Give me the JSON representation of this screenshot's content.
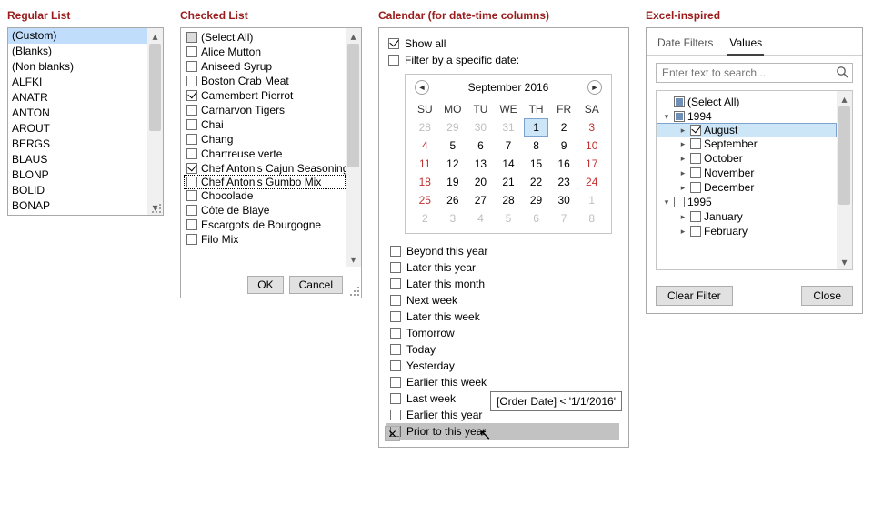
{
  "titles": {
    "regular": "Regular List",
    "checked": "Checked List",
    "calendar": "Calendar (for date-time columns)",
    "excel": "Excel-inspired"
  },
  "regular": {
    "items": [
      "(Custom)",
      "(Blanks)",
      "(Non blanks)",
      "ALFKI",
      "ANATR",
      "ANTON",
      "AROUT",
      "BERGS",
      "BLAUS",
      "BLONP",
      "BOLID",
      "BONAP"
    ],
    "selected_index": 0
  },
  "checked": {
    "items": [
      {
        "label": "(Select All)",
        "state": "ind"
      },
      {
        "label": "Alice Mutton",
        "state": "off"
      },
      {
        "label": "Aniseed Syrup",
        "state": "off"
      },
      {
        "label": "Boston Crab Meat",
        "state": "off"
      },
      {
        "label": "Camembert Pierrot",
        "state": "on"
      },
      {
        "label": "Carnarvon Tigers",
        "state": "off"
      },
      {
        "label": "Chai",
        "state": "off"
      },
      {
        "label": "Chang",
        "state": "off"
      },
      {
        "label": "Chartreuse verte",
        "state": "off"
      },
      {
        "label": "Chef Anton's Cajun Seasoning",
        "state": "on"
      },
      {
        "label": "Chef Anton's Gumbo Mix",
        "state": "off",
        "hover": true
      },
      {
        "label": "Chocolade",
        "state": "off"
      },
      {
        "label": "Côte de Blaye",
        "state": "off"
      },
      {
        "label": "Escargots de Bourgogne",
        "state": "off"
      },
      {
        "label": "Filo Mix",
        "state": "off"
      }
    ],
    "ok": "OK",
    "cancel": "Cancel"
  },
  "calendar": {
    "show_all": "Show all",
    "filter_date": "Filter by a specific date:",
    "month": "September 2016",
    "dow": [
      "SU",
      "MO",
      "TU",
      "WE",
      "TH",
      "FR",
      "SA"
    ],
    "weeks": [
      [
        {
          "n": "28",
          "o": true
        },
        {
          "n": "29",
          "o": true
        },
        {
          "n": "30",
          "o": true
        },
        {
          "n": "31",
          "o": true
        },
        {
          "n": "1",
          "today": true
        },
        {
          "n": "2"
        },
        {
          "n": "3",
          "sat": true
        }
      ],
      [
        {
          "n": "4",
          "sun": true
        },
        {
          "n": "5"
        },
        {
          "n": "6"
        },
        {
          "n": "7"
        },
        {
          "n": "8"
        },
        {
          "n": "9"
        },
        {
          "n": "10",
          "sat": true
        }
      ],
      [
        {
          "n": "11",
          "sun": true
        },
        {
          "n": "12"
        },
        {
          "n": "13"
        },
        {
          "n": "14"
        },
        {
          "n": "15"
        },
        {
          "n": "16"
        },
        {
          "n": "17",
          "sat": true
        }
      ],
      [
        {
          "n": "18",
          "sun": true
        },
        {
          "n": "19"
        },
        {
          "n": "20"
        },
        {
          "n": "21"
        },
        {
          "n": "22"
        },
        {
          "n": "23"
        },
        {
          "n": "24",
          "sat": true
        }
      ],
      [
        {
          "n": "25",
          "sun": true
        },
        {
          "n": "26"
        },
        {
          "n": "27"
        },
        {
          "n": "28"
        },
        {
          "n": "29"
        },
        {
          "n": "30"
        },
        {
          "n": "1",
          "o": true
        }
      ],
      [
        {
          "n": "2",
          "o": true
        },
        {
          "n": "3",
          "o": true
        },
        {
          "n": "4",
          "o": true
        },
        {
          "n": "5",
          "o": true
        },
        {
          "n": "6",
          "o": true
        },
        {
          "n": "7",
          "o": true
        },
        {
          "n": "8",
          "o": true
        }
      ]
    ],
    "presets": [
      "Beyond this year",
      "Later this year",
      "Later this month",
      "Next week",
      "Later this week",
      "Tomorrow",
      "Today",
      "Yesterday",
      "Earlier this week",
      "Last week",
      "Earlier this year",
      "Prior to this year"
    ],
    "hover_index": 11,
    "tooltip": "[Order Date] < '1/1/2016'"
  },
  "excel": {
    "tabs": {
      "date": "Date Filters",
      "values": "Values"
    },
    "active_tab": "values",
    "placeholder": "Enter text to search...",
    "tree": [
      {
        "depth": 0,
        "label": "(Select All)",
        "state": "ind",
        "expander": ""
      },
      {
        "depth": 0,
        "label": "1994",
        "state": "ind",
        "expander": "▾"
      },
      {
        "depth": 1,
        "label": "August",
        "state": "on",
        "expander": "▸",
        "sel": true
      },
      {
        "depth": 1,
        "label": "September",
        "state": "off",
        "expander": "▸"
      },
      {
        "depth": 1,
        "label": "October",
        "state": "off",
        "expander": "▸"
      },
      {
        "depth": 1,
        "label": "November",
        "state": "off",
        "expander": "▸"
      },
      {
        "depth": 1,
        "label": "December",
        "state": "off",
        "expander": "▸"
      },
      {
        "depth": 0,
        "label": "1995",
        "state": "off",
        "expander": "▾"
      },
      {
        "depth": 1,
        "label": "January",
        "state": "off",
        "expander": "▸"
      },
      {
        "depth": 1,
        "label": "February",
        "state": "off",
        "expander": "▸"
      }
    ],
    "clear": "Clear Filter",
    "close": "Close"
  }
}
